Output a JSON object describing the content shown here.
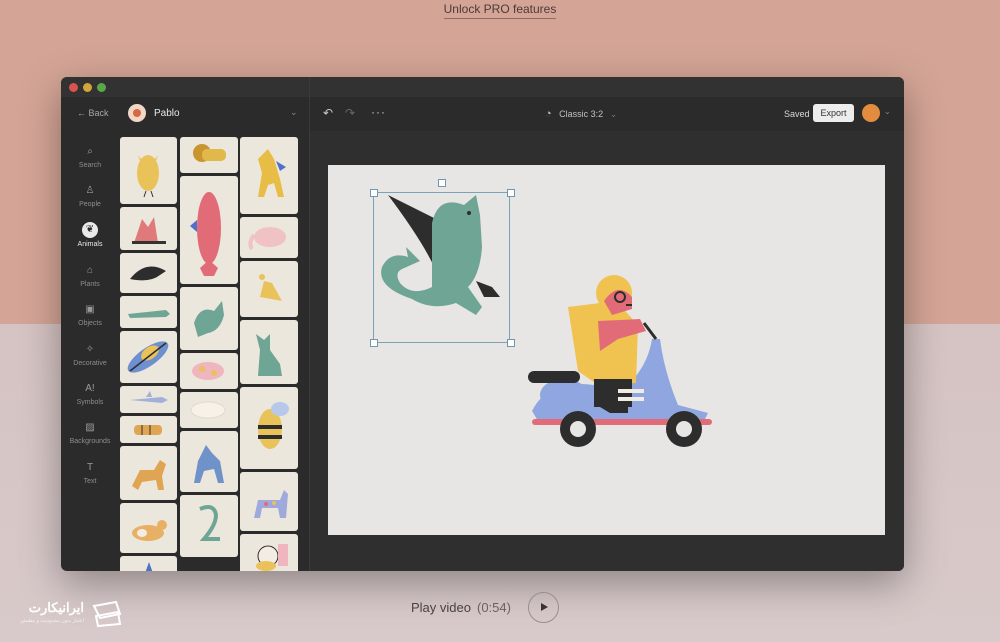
{
  "promo": {
    "link_label": "Unlock PRO features"
  },
  "topbar": {
    "back_label": "← Back",
    "project_name": "Pablo",
    "chevron": "⌄",
    "undo_icon": "↶",
    "redo_icon": "↷",
    "more_icon": "···",
    "format_icon": "◔",
    "format_label": "Classic  3:2",
    "format_chevron": "⌄",
    "saved_label": "Saved",
    "export_label": "Export",
    "user_chevron": "⌄"
  },
  "sidebar": {
    "items": [
      {
        "label": "Search",
        "icon": "⌕",
        "active": false
      },
      {
        "label": "People",
        "icon": "♙",
        "active": false
      },
      {
        "label": "Animals",
        "icon": "❦",
        "active": true
      },
      {
        "label": "Plants",
        "icon": "⌂",
        "active": false
      },
      {
        "label": "Objects",
        "icon": "▣",
        "active": false
      },
      {
        "label": "Decorative",
        "icon": "✧",
        "active": false
      },
      {
        "label": "Symbols",
        "icon": "A!",
        "active": false
      },
      {
        "label": "Backgrounds",
        "icon": "▨",
        "active": false
      },
      {
        "label": "Text",
        "icon": "T",
        "active": false
      }
    ]
  },
  "assets": {
    "tiles": [
      {
        "name": "owl",
        "color": "#e9c25a"
      },
      {
        "name": "lion",
        "color": "#e1b94a"
      },
      {
        "name": "horse",
        "color": "#e8bd45"
      },
      {
        "name": "fish",
        "color": "#e26b78"
      },
      {
        "name": "fox",
        "color": "#e07a7a"
      },
      {
        "name": "elephant",
        "color": "#f0c2c4"
      },
      {
        "name": "whale",
        "color": "#2d2d2d"
      },
      {
        "name": "bird",
        "color": "#e9c25a"
      },
      {
        "name": "crocodile",
        "color": "#6ea594"
      },
      {
        "name": "dragon",
        "color": "#6ea594"
      },
      {
        "name": "cat",
        "color": "#6ea594"
      },
      {
        "name": "feather",
        "color": "#6e8fd0"
      },
      {
        "name": "pig",
        "color": "#efb6c0"
      },
      {
        "name": "shark",
        "color": "#9fb1d8"
      },
      {
        "name": "bee",
        "color": "#e9c25a"
      },
      {
        "name": "polar-bear",
        "color": "#f2ece4"
      },
      {
        "name": "tiger",
        "color": "#e0a552"
      },
      {
        "name": "dog",
        "color": "#e0a552"
      },
      {
        "name": "wolf",
        "color": "#6f93c8"
      },
      {
        "name": "dalmatian",
        "color": "#9fa9dc"
      },
      {
        "name": "corgi",
        "color": "#e7b065"
      },
      {
        "name": "snake",
        "color": "#6ea594"
      },
      {
        "name": "hamster",
        "color": "#e9c25a"
      },
      {
        "name": "blue-figure",
        "color": "#4f71c6"
      }
    ]
  },
  "canvas": {
    "dragon_color": "#6ea594",
    "wing_color": "#2d2d2d",
    "helmet_color": "#f0c24f",
    "scooter_color": "#8fa6e0",
    "accent_pink": "#e26b78"
  },
  "player": {
    "label": "Play video",
    "duration": "(0:54)"
  },
  "watermark": {
    "title": "ایرانیکارت",
    "subtitle": "اعتبار بدون محدودیت و مطمئن"
  }
}
